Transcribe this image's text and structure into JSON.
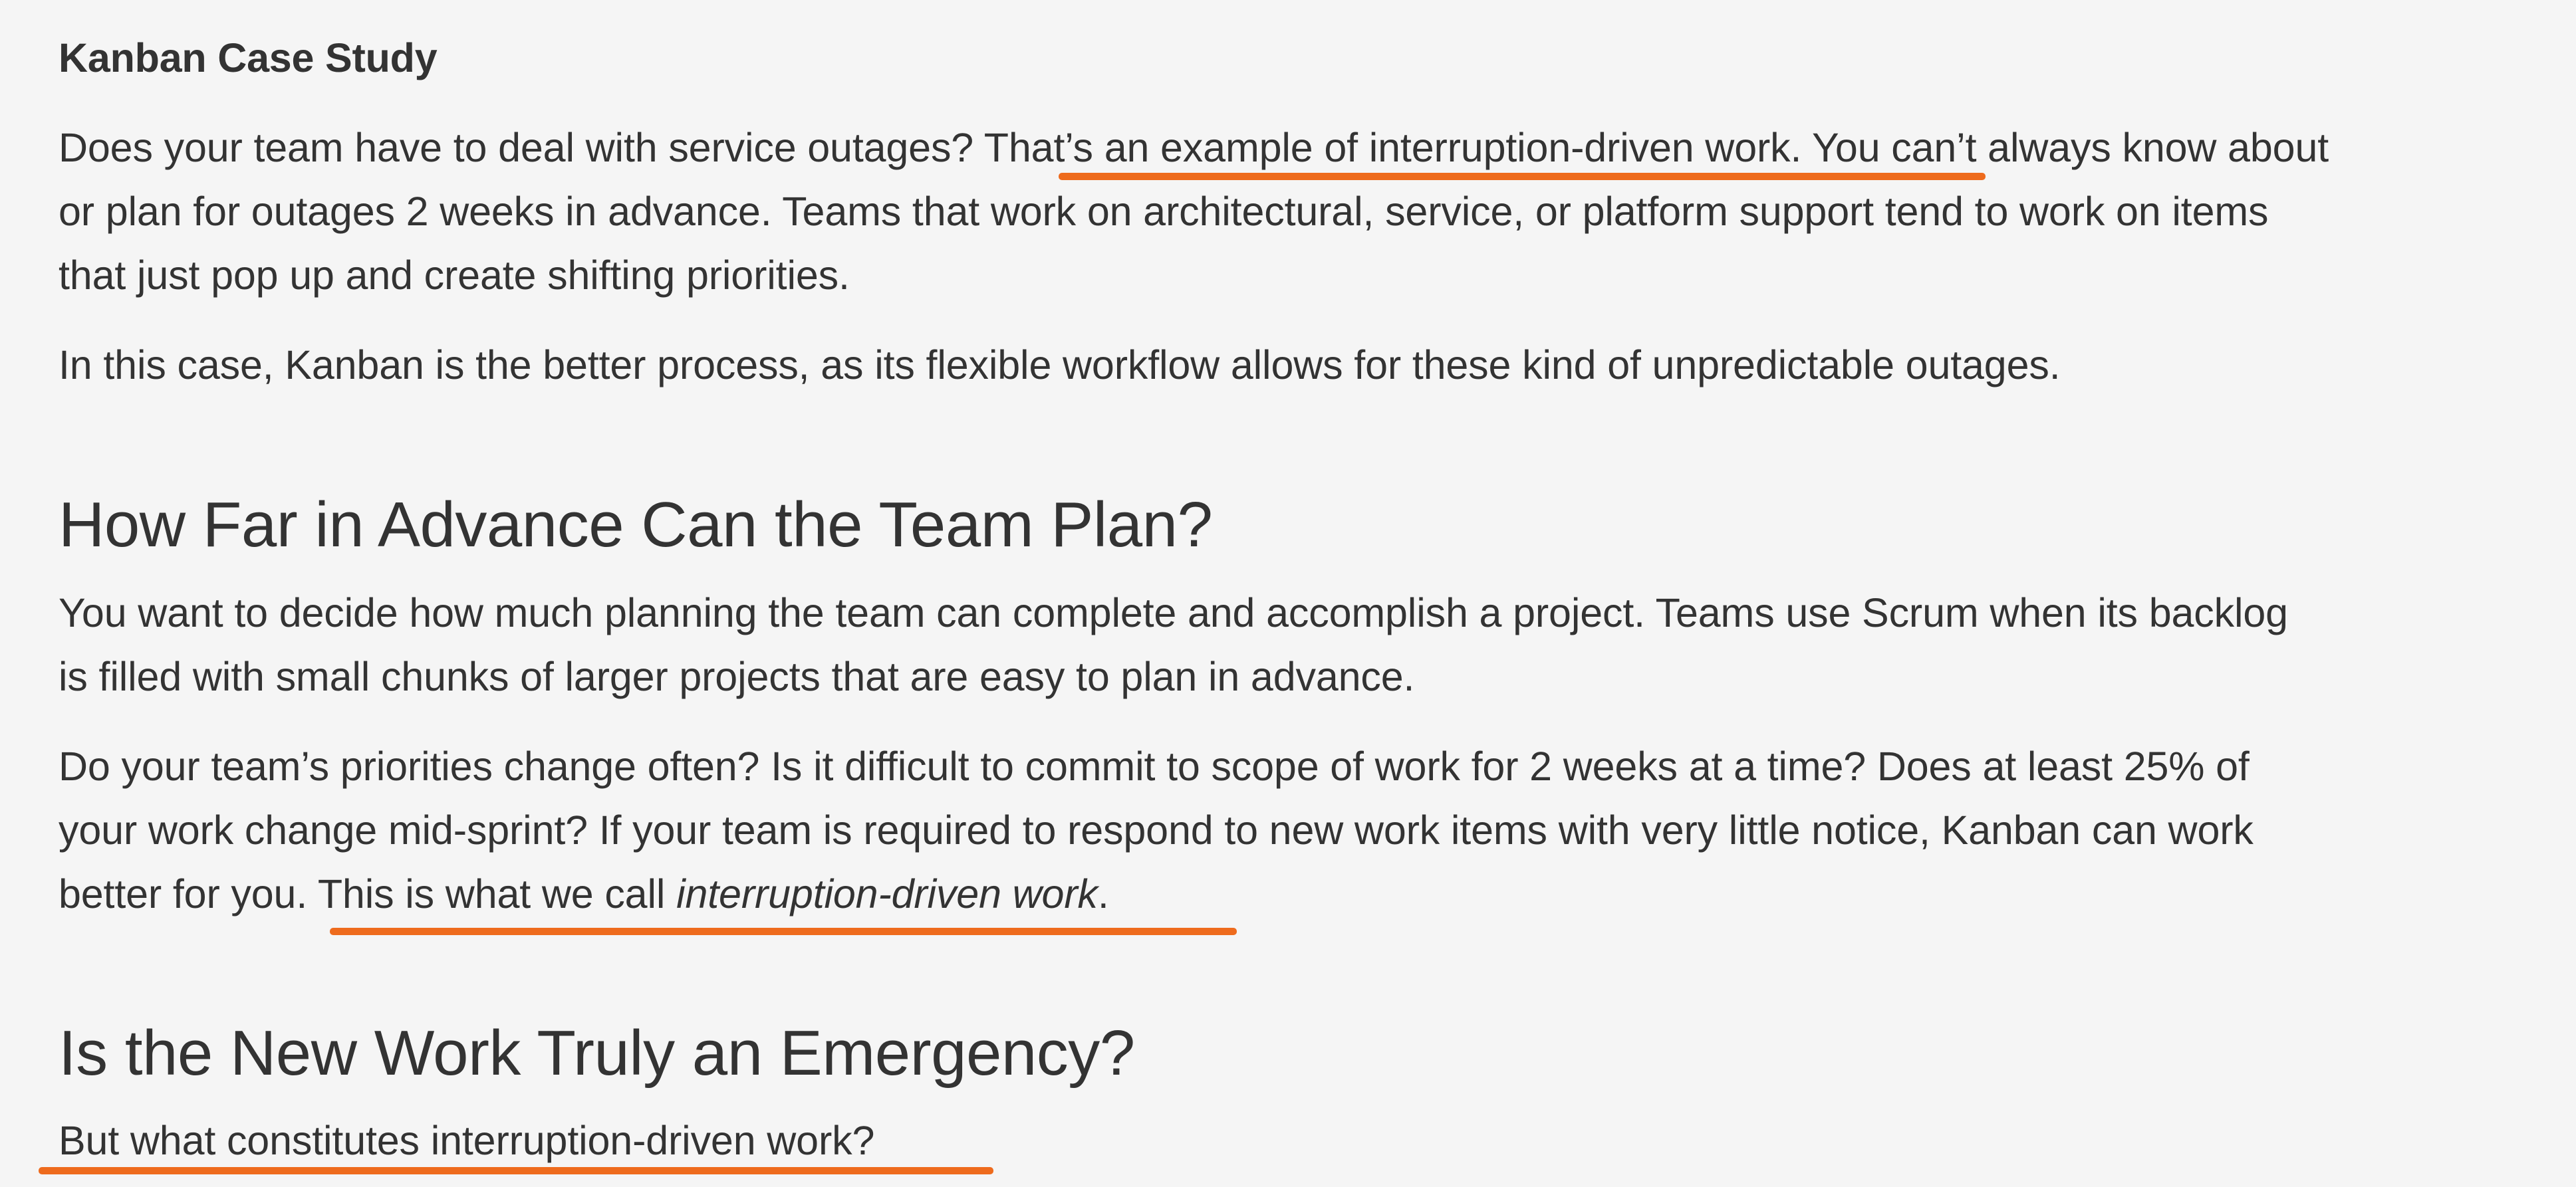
{
  "section_kanban": {
    "heading": "Kanban Case Study",
    "p1": {
      "l1_a": "Does your team have to deal with service outages? ",
      "l1_b": "That’s an example of interruption-driven work.",
      "l1_c": " You can’t always know about",
      "l2": "or plan for outages 2 weeks in advance. Teams that work on architectural, service, or platform support tend to work on items",
      "l3": "that just pop up and create shifting priorities."
    },
    "p2": "In this case, Kanban is the better process, as its flexible workflow allows for these kind of unpredictable outages."
  },
  "section_plan": {
    "heading": "How Far in Advance Can the Team Plan?",
    "p1": {
      "l1": "You want to decide how much planning the team can complete and accomplish a project. Teams use Scrum when its backlog",
      "l2": "is filled with small chunks of larger projects that are easy to plan in advance."
    },
    "p2": {
      "l1": "Do your team’s priorities change often? Is it difficult to commit to scope of work for 2 weeks at a time? Does at least 25% of",
      "l2": "your work change mid-sprint? If your team is required to respond to new work items with very little notice, Kanban can work",
      "l3_a": "better for you.",
      "l3_b": " This is what we call ",
      "l3_c": "interruption-driven work",
      "l3_d": "."
    }
  },
  "section_emergency": {
    "heading": "Is the New Work Truly an Emergency?",
    "p1": "But what constitutes interruption-driven work?"
  },
  "colors": {
    "background": "#f5f5f5",
    "text": "#333333",
    "highlight_underline": "#ee6b1d"
  }
}
